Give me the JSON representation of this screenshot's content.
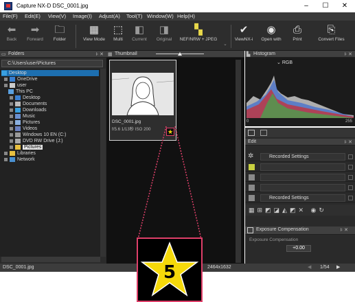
{
  "window": {
    "title": "Capture NX-D    DSC_0001.jpg",
    "minimize": "–",
    "maximize": "☐",
    "close": "✕"
  },
  "menu": [
    "File(F)",
    "Edit(E)",
    "View(V)",
    "Image(I)",
    "Adjust(A)",
    "Tool(T)",
    "Window(W)",
    "Help(H)"
  ],
  "toolbar": {
    "back": "Back",
    "forward": "Forward",
    "folder": "Folder",
    "view_mode": "View Mode",
    "multi": "Multi",
    "current": "Current",
    "original": "Original",
    "nef_label": "NEF/NRW + JPEG",
    "viewnx": "ViewNX-i",
    "open_with": "Open with",
    "print": "Print",
    "convert": "Convert Files"
  },
  "folders": {
    "title": "Folders",
    "path": "C:\\Users\\user\\Pictures",
    "items": [
      "Desktop",
      "OneDrive",
      "user",
      "This PC",
      "Desktop",
      "Documents",
      "Downloads",
      "Music",
      "Pictures",
      "Videos",
      "Windows 10 EN (C:)",
      "DVD RW Drive (J:)",
      "Pictures",
      "Libraries",
      "Network"
    ]
  },
  "thumbnail": {
    "title": "Thumbnail",
    "filename": "DSC_0001.jpg",
    "info": "f/5.6 1/13秒 ISO 200"
  },
  "histogram": {
    "title": "Histogram",
    "channel": "RGB",
    "min": "0",
    "max": "255"
  },
  "edit": {
    "title": "Edit",
    "rows": [
      "Recorded Settings",
      "",
      "",
      "",
      "Recorded Settings"
    ],
    "exposure_title": "Exposure Compensation",
    "exposure_label": "Exposure Compensation",
    "exposure_value": "+0.00"
  },
  "status": {
    "file": "DSC_0001.jpg",
    "dims": "2464x1632",
    "page": "1/54"
  },
  "callout": {
    "number": "5",
    "colors": {
      "border": "#e0406a",
      "star": "#f5d90a"
    }
  }
}
